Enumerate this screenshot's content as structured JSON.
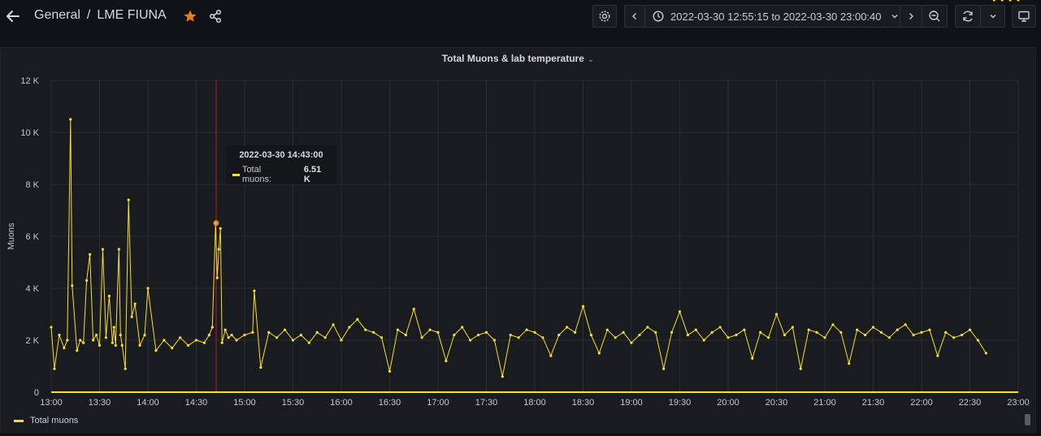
{
  "header": {
    "folder": "General",
    "separator": "/",
    "dashboard_title": "LME FIUNA",
    "time_range": "2022-03-30 12:55:15 to 2022-03-30 23:00:40",
    "star_color": "#eb7b18"
  },
  "panel": {
    "title": "Total Muons & lab temperature"
  },
  "tooltip": {
    "time": "2022-03-30 14:43:00",
    "series_label": "Total muons:",
    "value": "6.51 K"
  },
  "legend": {
    "label": "Total muons",
    "color": "#fade2a"
  },
  "chart_data": {
    "type": "line",
    "ylabel": "Muons",
    "yticks": [
      "0",
      "2 K",
      "4 K",
      "6 K",
      "8 K",
      "10 K",
      "12 K"
    ],
    "ylim": [
      0,
      12000
    ],
    "xticks": [
      "13:00",
      "13:30",
      "14:00",
      "14:30",
      "15:00",
      "15:30",
      "16:00",
      "16:30",
      "17:00",
      "17:30",
      "18:00",
      "18:30",
      "19:00",
      "19:30",
      "20:00",
      "20:30",
      "21:00",
      "21:30",
      "22:00",
      "22:30",
      "23:00"
    ],
    "grid": true,
    "series": [
      {
        "name": "Total muons",
        "color": "#fade2a",
        "x_minutes_after_13": [
          0,
          2,
          5,
          8,
          10,
          12,
          13,
          16,
          18,
          20,
          22,
          24,
          26,
          28,
          30,
          32,
          34,
          36,
          38,
          39,
          40,
          42,
          43,
          44,
          46,
          48,
          50,
          52,
          55,
          58,
          60,
          65,
          70,
          75,
          80,
          85,
          90,
          95,
          98,
          100,
          102,
          103,
          104,
          105,
          106,
          108,
          110,
          112,
          115,
          120,
          125,
          126,
          130,
          135,
          140,
          145,
          150,
          155,
          160,
          165,
          170,
          175,
          180,
          185,
          190,
          195,
          200,
          205,
          210,
          215,
          220,
          225,
          230,
          235,
          240,
          245,
          250,
          255,
          260,
          265,
          270,
          275,
          280,
          285,
          290,
          295,
          300,
          305,
          310,
          315,
          320,
          325,
          330,
          335,
          340,
          345,
          350,
          355,
          360,
          365,
          370,
          375,
          380,
          385,
          390,
          395,
          400,
          405,
          410,
          415,
          420,
          425,
          430,
          435,
          440,
          445,
          450,
          455,
          460,
          465,
          470,
          475,
          480,
          485,
          490,
          495,
          500,
          505,
          510,
          515,
          520,
          525,
          530,
          535,
          540,
          545,
          550,
          555,
          560,
          565,
          570,
          575,
          580,
          585,
          590,
          595,
          600
        ],
        "values": [
          2500,
          900,
          2200,
          1700,
          2000,
          10500,
          4100,
          1600,
          2000,
          1900,
          4300,
          5300,
          2000,
          2200,
          1800,
          5500,
          2100,
          3700,
          1900,
          2500,
          1800,
          5500,
          2200,
          1800,
          900,
          7400,
          2900,
          3400,
          1800,
          2200,
          4000,
          1600,
          2000,
          1700,
          2100,
          1800,
          2000,
          1900,
          2200,
          2500,
          6500,
          4400,
          5500,
          6300,
          1900,
          2400,
          2100,
          2200,
          2000,
          2200,
          2300,
          3900,
          950,
          2300,
          2100,
          2400,
          2000,
          2200,
          1900,
          2300,
          2100,
          2600,
          2000,
          2500,
          2800,
          2400,
          2300,
          2100,
          800,
          2400,
          2200,
          3200,
          2100,
          2400,
          2300,
          1200,
          2200,
          2500,
          2000,
          2200,
          2300,
          2000,
          600,
          2200,
          2100,
          2400,
          2300,
          2100,
          1400,
          2200,
          2500,
          2300,
          3300,
          2200,
          1500,
          2400,
          2100,
          2300,
          1900,
          2200,
          2500,
          2300,
          900,
          2300,
          3100,
          2200,
          2400,
          2000,
          2300,
          2500,
          2100,
          2200,
          2400,
          1300,
          2300,
          2100,
          3000,
          2200,
          2500,
          900,
          2400,
          2300,
          2100,
          2600,
          2300,
          1100,
          2400,
          2200,
          2500,
          2300,
          2100,
          2400,
          2600,
          2200,
          2300,
          2400,
          1400,
          2300,
          2100,
          2200,
          2400,
          2000,
          1500
        ]
      }
    ]
  }
}
